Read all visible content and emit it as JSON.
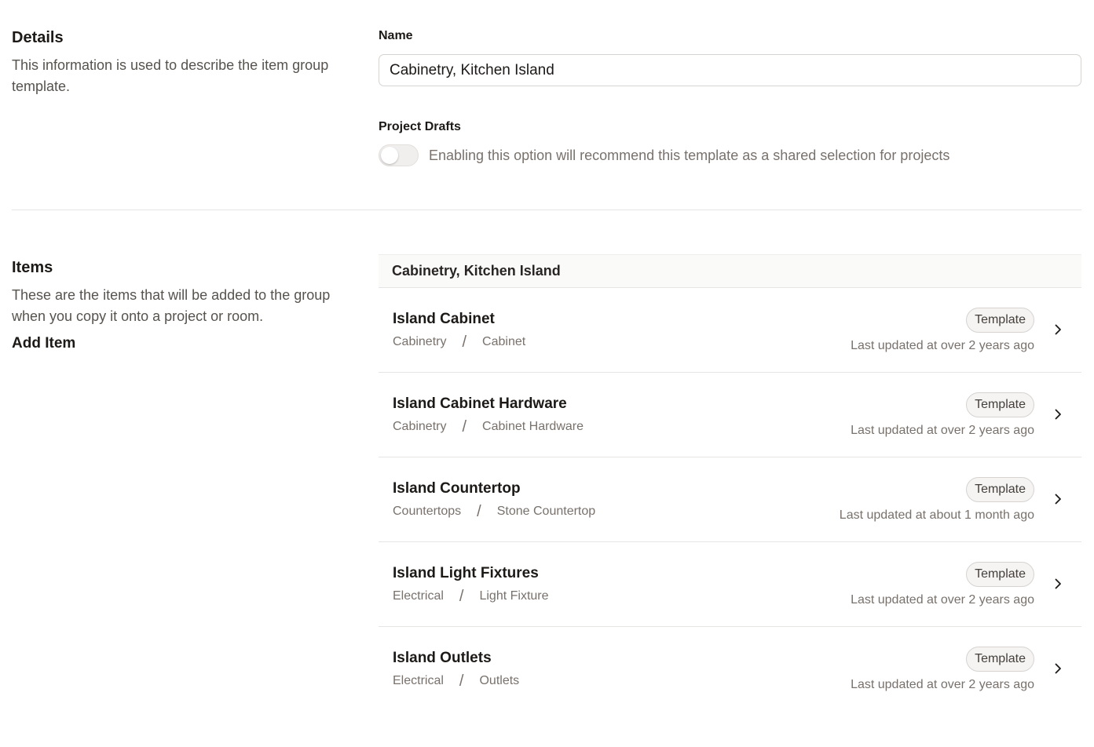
{
  "details": {
    "title": "Details",
    "description": "This information is used to describe the item group template."
  },
  "name_field": {
    "label": "Name",
    "value": "Cabinetry, Kitchen Island"
  },
  "project_drafts": {
    "label": "Project Drafts",
    "toggle_on": false,
    "description": "Enabling this option will recommend this template as a shared selection for projects"
  },
  "items_section": {
    "title": "Items",
    "description": "These are the items that will be added to the group when you copy it onto a project or room.",
    "add_item_label": "Add Item"
  },
  "group": {
    "header": "Cabinetry, Kitchen Island",
    "items": [
      {
        "name": "Island Cabinet",
        "category": "Cabinetry",
        "type": "Cabinet",
        "badge": "Template",
        "updated": "Last updated at over 2 years ago",
        "icon": "chevron-right-icon"
      },
      {
        "name": "Island Cabinet Hardware",
        "category": "Cabinetry",
        "type": "Cabinet Hardware",
        "badge": "Template",
        "updated": "Last updated at over 2 years ago",
        "icon": "chevron-right-icon"
      },
      {
        "name": "Island Countertop",
        "category": "Countertops",
        "type": "Stone Countertop",
        "badge": "Template",
        "updated": "Last updated at about 1 month ago",
        "icon": "chevron-right-icon"
      },
      {
        "name": "Island Light Fixtures",
        "category": "Electrical",
        "type": "Light Fixture",
        "badge": "Template",
        "updated": "Last updated at over 2 years ago",
        "icon": "chevron-right-icon"
      },
      {
        "name": "Island Outlets",
        "category": "Electrical",
        "type": "Outlets",
        "badge": "Template",
        "updated": "Last updated at over 2 years ago",
        "icon": "chevron-right-icon"
      }
    ],
    "separator": "/"
  }
}
